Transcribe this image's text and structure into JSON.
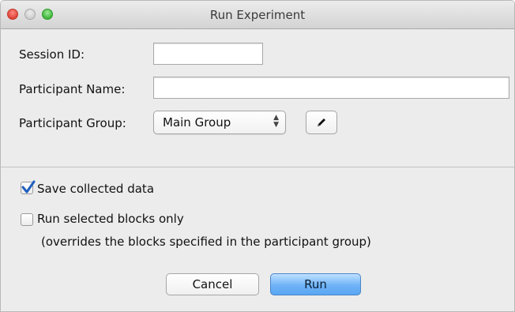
{
  "window": {
    "title": "Run Experiment"
  },
  "form": {
    "session_id": {
      "label": "Session ID:",
      "value": ""
    },
    "participant_name": {
      "label": "Participant Name:",
      "value": ""
    },
    "participant_group": {
      "label": "Participant Group:",
      "selected": "Main Group"
    },
    "edit_icon": "pencil-icon"
  },
  "options": {
    "save_data": {
      "label": "Save collected data",
      "checked": true
    },
    "run_selected": {
      "label": "Run selected blocks only",
      "note": "(overrides the blocks specified in the participant group)",
      "checked": false
    }
  },
  "buttons": {
    "cancel": "Cancel",
    "run": "Run"
  },
  "colors": {
    "accent": "#3b82f6",
    "checkmark": "#1f5fbf"
  }
}
